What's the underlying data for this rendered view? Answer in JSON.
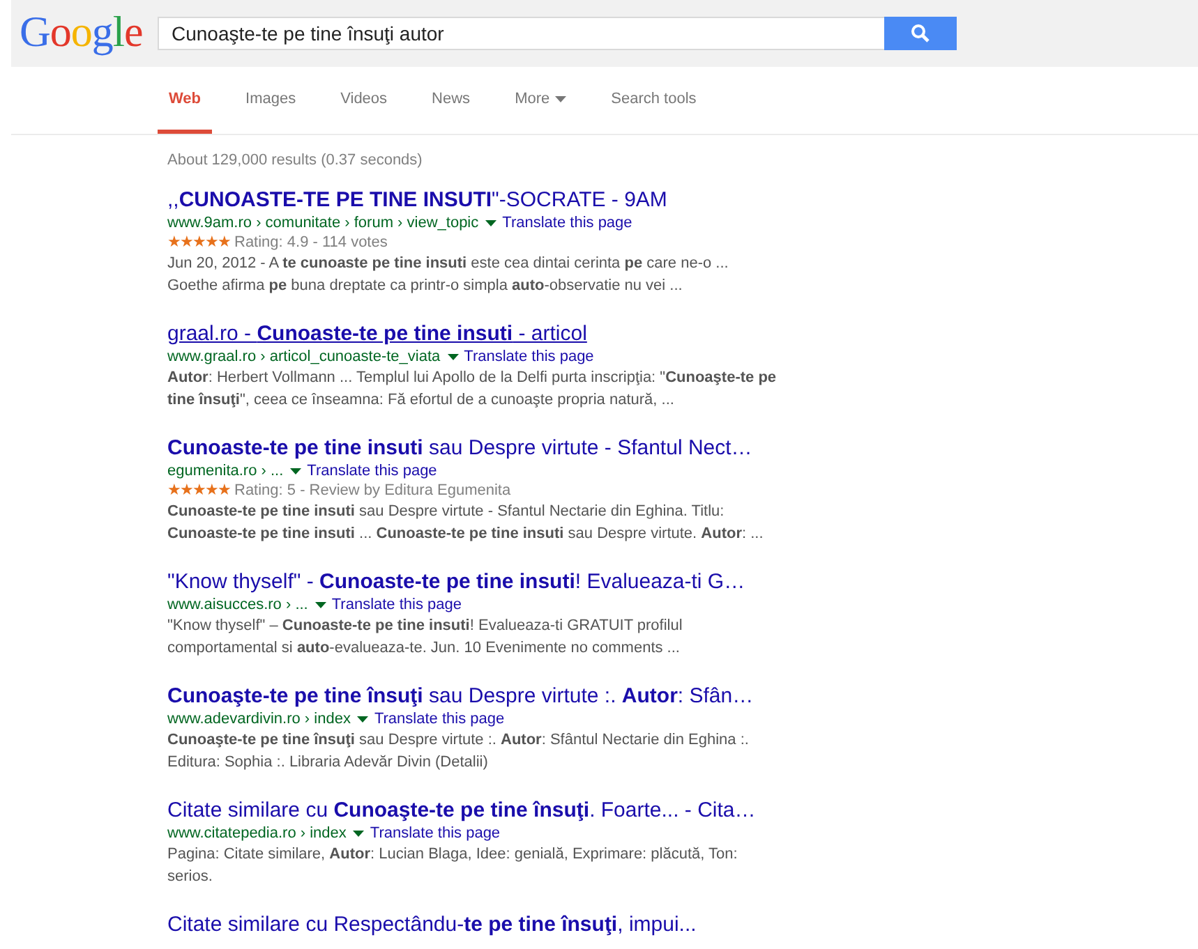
{
  "logo": "Google",
  "search": {
    "value": "Cunoaşte-te pe tine însuţi autor"
  },
  "tabs": [
    {
      "label": "Web",
      "selected": true,
      "kind": "tab"
    },
    {
      "label": "Images",
      "selected": false,
      "kind": "tab"
    },
    {
      "label": "Videos",
      "selected": false,
      "kind": "tab"
    },
    {
      "label": "News",
      "selected": false,
      "kind": "tab"
    },
    {
      "label": "More",
      "selected": false,
      "kind": "menu"
    },
    {
      "label": "Search tools",
      "selected": false,
      "kind": "tab"
    }
  ],
  "result_stats": "About 129,000 results (0.37 seconds)",
  "results": [
    {
      "title": ",,**CUNOASTE-TE PE TINE INSUTI**\"-SOCRATE - 9AM",
      "underlined": false,
      "url": "www.9am.ro › comunitate › forum › view_topic",
      "translate": "Translate this page",
      "stars": 5,
      "rating": "Rating: 4.9 - 114 votes",
      "snippet": "Jun 20, 2012 - A **te cunoaste pe tine insuti** este cea dintai cerinta **pe** care ne-o ... Goethe afirma **pe** buna dreptate ca printr-o simpla **auto**-observatie nu vei ..."
    },
    {
      "title": "graal.ro - **Cunoaste-te pe tine insuti** - articol",
      "underlined": true,
      "url": "www.graal.ro › articol_cunoaste-te_viata",
      "translate": "Translate this page",
      "snippet": "**Autor**: Herbert Vollmann ... Templul lui Apollo de la Delfi purta inscripţia: \"**Cunoaşte-te pe tine însuţi**\", ceea ce înseamna: Fă efortul de a cunoaşte propria natură, ..."
    },
    {
      "title": "**Cunoaste-te pe tine insuti** sau Despre virtute - Sfantul Nect…",
      "underlined": false,
      "url": "egumenita.ro › ...",
      "translate": "Translate this page",
      "stars": 5,
      "rating": "Rating: 5 - Review by Editura Egumenita",
      "snippet": "**Cunoaste-te pe tine insuti** sau Despre virtute - Sfantul Nectarie din Eghina. Titlu: **Cunoaste-te pe tine insuti** ... **Cunoaste-te pe tine insuti** sau Despre virtute. **Autor**: ..."
    },
    {
      "title": "\"Know thyself\" - **Cunoaste-te pe tine insuti**! Evalueaza-ti G…",
      "underlined": false,
      "url": "www.aisucces.ro › ...",
      "translate": "Translate this page",
      "snippet": "\"Know thyself\" – **Cunoaste-te pe tine insuti**! Evalueaza-ti GRATUIT profilul comportamental si **auto**-evalueaza-te. Jun. 10 Evenimente no comments ..."
    },
    {
      "title": "**Cunoaşte-te pe tine însuţi** sau Despre virtute :. **Autor**: Sfân…",
      "underlined": false,
      "url": "www.adevardivin.ro › index",
      "translate": "Translate this page",
      "snippet": "**Cunoaşte-te pe tine însuţi** sau Despre virtute :. **Autor**: Sfântul Nectarie din Eghina :. Editura: Sophia :. Libraria Adevăr Divin (Detalii)"
    },
    {
      "title": "Citate similare cu **Cunoaşte-te pe tine însuţi**. Foarte... - Cita…",
      "underlined": false,
      "url": "www.citatepedia.ro › index",
      "translate": "Translate this page",
      "snippet": "Pagina: Citate similare, **Autor**: Lucian Blaga, Idee: genială, Exprimare: plăcută, Ton: serios."
    },
    {
      "title": "Citate similare cu Respectându-**te pe tine însuţi**, impui...",
      "underlined": false
    }
  ]
}
